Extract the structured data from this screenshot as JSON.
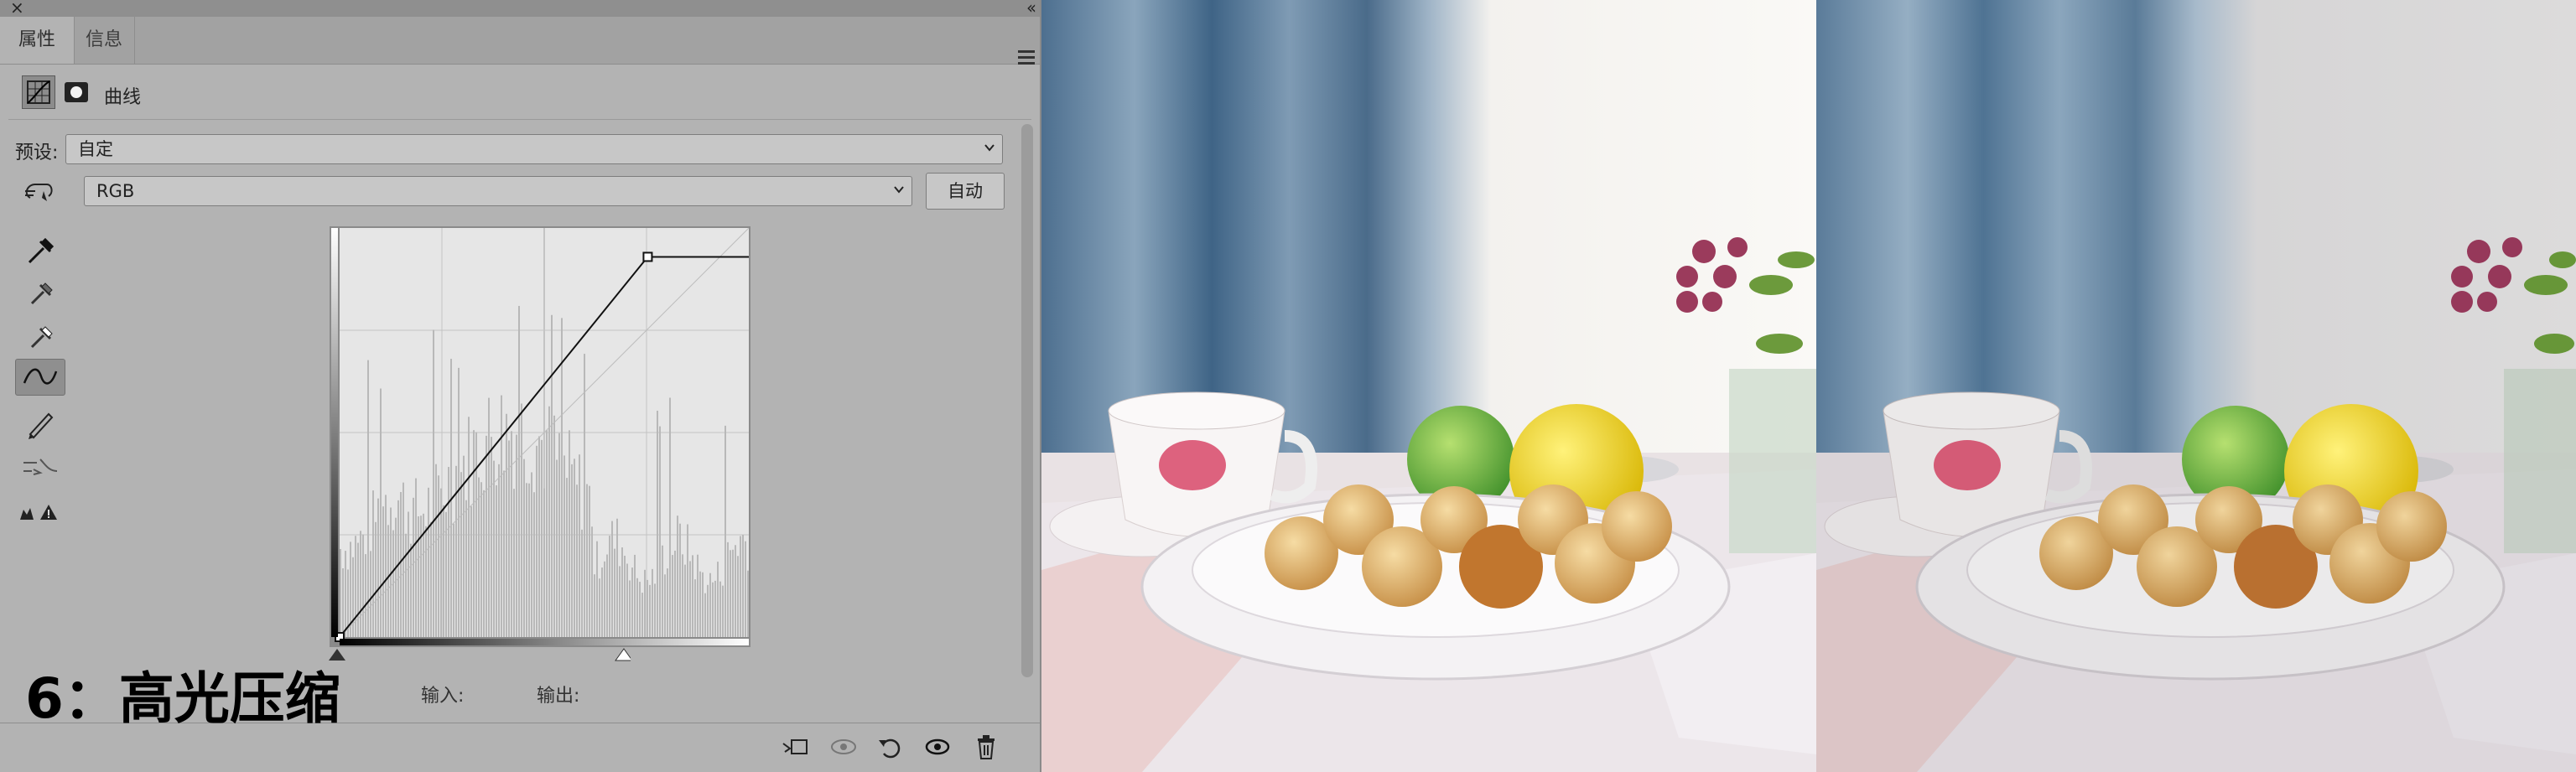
{
  "panel": {
    "tabs": [
      {
        "label": "属性"
      },
      {
        "label": "信息"
      }
    ],
    "adjustment_title": "曲线",
    "preset_label": "预设:",
    "preset_value": "自定",
    "channel_value": "RGB",
    "auto_label": "自动",
    "input_label": "输入:",
    "output_label": "输出:"
  },
  "caption": "6：高光压缩",
  "curve": {
    "points": [
      [
        0,
        0
      ],
      [
        192,
        237
      ],
      [
        255,
        237
      ]
    ]
  },
  "colors": {
    "panel_bg": "#b3b3b3",
    "tab_bar": "#a2a2a2",
    "graph_bg": "#e6e6e6"
  },
  "icons": [
    "close-icon",
    "collapse-icon",
    "panel-menu-icon",
    "curves-adjustment-icon",
    "mask-icon",
    "on-image-adjust-icon",
    "black-point-eyedropper-icon",
    "gray-point-eyedropper-icon",
    "white-point-eyedropper-icon",
    "edit-points-icon",
    "draw-curve-icon",
    "smooth-icon",
    "clipping-warning-icon",
    "clip-to-layer-icon",
    "view-previous-icon",
    "reset-icon",
    "visibility-icon",
    "delete-icon"
  ]
}
